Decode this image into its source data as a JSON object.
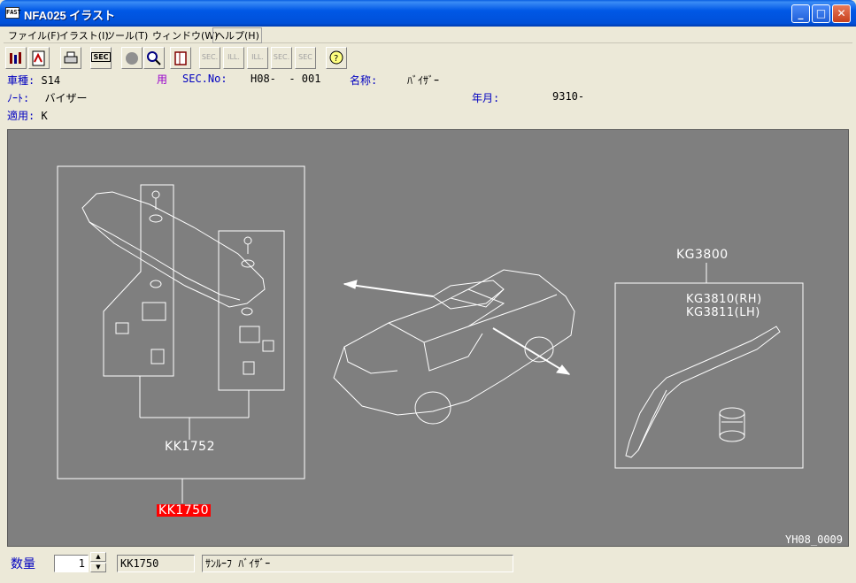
{
  "window": {
    "title": "NFA025 イラスト",
    "app_icon_text": "FAST"
  },
  "menu": [
    "ファイル(F)",
    "イラスト(I)",
    "ツール(T)",
    "ウィンドウ(W)",
    "ヘルプ(H)"
  ],
  "toolbar": {
    "sec": "SEC",
    "sec_prev": "SEC.",
    "ill_prev": "ILL.",
    "ill_next": "ILL.",
    "sec_next": "SEC.",
    "sec_q": "SEC",
    "icons": [
      "illustration-icon",
      "pdf-icon",
      "print-icon",
      "sec-icon",
      "circle-icon",
      "magnify-icon",
      "book-icon",
      "sec-prev-icon",
      "ill-prev-icon",
      "ill-next-icon",
      "sec-next-icon",
      "sec-search-icon",
      "help-icon"
    ]
  },
  "info": {
    "model_label": "車種:",
    "model_value": "S14",
    "use_label": "用",
    "sec_label": "SEC.No:",
    "sec_value": "H08-  - 001",
    "name_label": "名称:",
    "name_value": "ﾊﾞｲｻﾞｰ",
    "note_label": "ﾉｰﾄ:",
    "note_value": "バイザー",
    "date_label": "年月:",
    "date_value": "9310-",
    "apply_label": "適用:",
    "apply_value": "K"
  },
  "illustration": {
    "labels": {
      "kk1752": "KK1752",
      "kk1750": "KK1750",
      "kg3800": "KG3800",
      "kg3810": "KG3810(RH)",
      "kg3811": "KG3811(LH)"
    },
    "figure_id": "YH08_0009"
  },
  "bottom": {
    "qty_label": "数量",
    "qty_value": "1",
    "part_code": "KK1750",
    "part_name": "ｻﾝﾙｰﾌ ﾊﾞｲｻﾞｰ"
  },
  "colors": {
    "canvas_bg": "#7f7f7f",
    "selection": "#ff0000",
    "label_blue": "#0000c0",
    "label_purple": "#9900cc"
  }
}
